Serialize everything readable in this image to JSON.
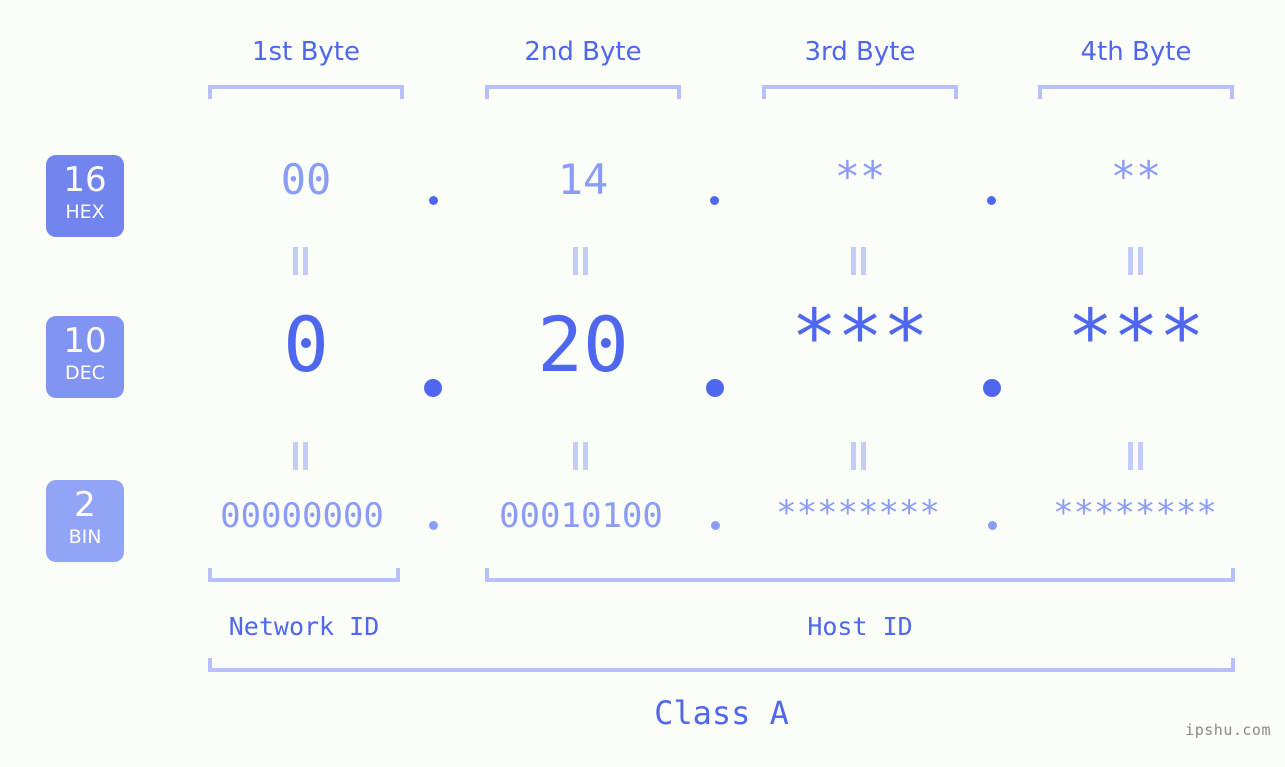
{
  "page": {
    "background_color": "#fbfdf8",
    "accent_strong": "#4f67ee",
    "accent_light": "#8b9cf7",
    "bracket_color": "#b7c0fb",
    "watermark": "ipshu.com"
  },
  "headers": [
    {
      "label": "1st Byte"
    },
    {
      "label": "2nd Byte"
    },
    {
      "label": "3rd Byte"
    },
    {
      "label": "4th Byte"
    }
  ],
  "bases": [
    {
      "number": "16",
      "name": "HEX",
      "color": "#7285ef"
    },
    {
      "number": "10",
      "name": "DEC",
      "color": "#8294f2"
    },
    {
      "number": "2",
      "name": "BIN",
      "color": "#92a4f6"
    }
  ],
  "separators": {
    "hex": ".",
    "dec": ".",
    "bin": "."
  },
  "equals_symbol": "=",
  "rows": {
    "hex": {
      "base": "16",
      "name": "HEX",
      "values": [
        "00",
        "14",
        "**",
        "**"
      ]
    },
    "dec": {
      "base": "10",
      "name": "DEC",
      "values": [
        "0",
        "20",
        "***",
        "***"
      ]
    },
    "bin": {
      "base": "2",
      "name": "BIN",
      "values": [
        "00000000",
        "00010100",
        "********",
        "********"
      ]
    }
  },
  "sections": [
    {
      "label": "Network ID"
    },
    {
      "label": "Host ID"
    }
  ],
  "class": {
    "label": "Class A"
  }
}
